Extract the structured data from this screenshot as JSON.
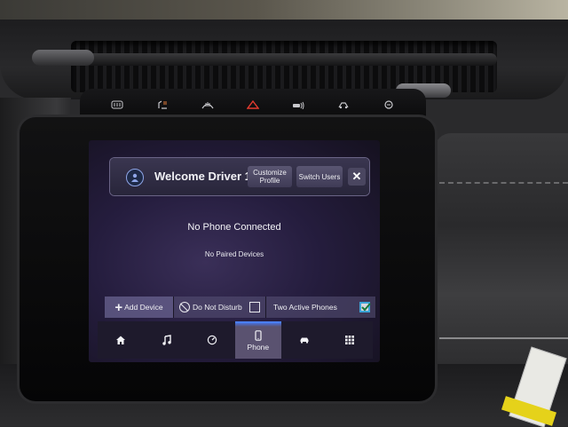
{
  "header": {
    "welcome_text": "Welcome Driver 1",
    "customize_line1": "Customize",
    "customize_line2": "Profile",
    "switch_users": "Switch Users",
    "close_glyph": "✕"
  },
  "phone_panel": {
    "status": "No Phone Connected",
    "paired": "No Paired Devices"
  },
  "actions": {
    "add_device": "Add Device",
    "do_not_disturb": "Do Not Disturb",
    "do_not_disturb_checked": false,
    "two_active_phones": "Two Active Phones",
    "two_active_phones_checked": true
  },
  "nav": {
    "items": [
      {
        "icon": "home-icon",
        "label": ""
      },
      {
        "icon": "music-icon",
        "label": ""
      },
      {
        "icon": "gauge-icon",
        "label": ""
      },
      {
        "icon": "phone-icon",
        "label": "Phone",
        "active": true
      },
      {
        "icon": "car-icon",
        "label": ""
      },
      {
        "icon": "apps-grid-icon",
        "label": ""
      }
    ]
  },
  "hardware_buttons": [
    {
      "icon": "rear-defrost-icon"
    },
    {
      "icon": "seat-heat-icon"
    },
    {
      "icon": "front-defrost-icon"
    },
    {
      "icon": "hazard-icon"
    },
    {
      "icon": "parking-sensor-icon"
    },
    {
      "icon": "drive-mode-icon"
    },
    {
      "icon": "stop-start-icon"
    }
  ],
  "colors": {
    "accent_blue": "#4a7ef0",
    "hazard_red": "#e33b2f",
    "screen_purple": "#251d3e"
  }
}
